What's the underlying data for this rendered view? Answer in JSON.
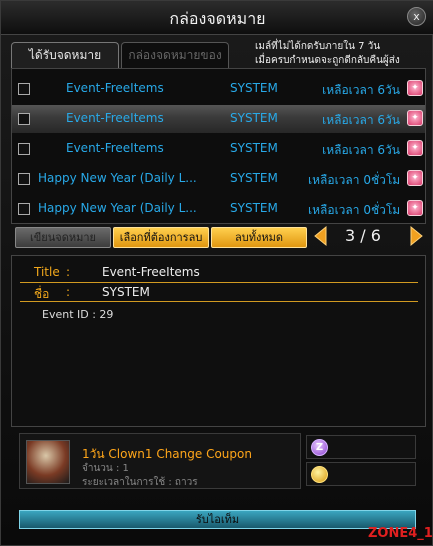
{
  "window": {
    "title": "กล่องจดหมาย",
    "close_label": "x"
  },
  "tabs": [
    {
      "label": "ได้รับจดหมาย",
      "active": true
    },
    {
      "label": "กล่องจดหมายของไอดี",
      "active": false
    }
  ],
  "notice": {
    "line1": "เมล์ที่ไม่ได้กดรับภายใน 7 วัน",
    "line2": "เมื่อครบกำหนดจะถูกดีกลับคืนผู้ส่ง"
  },
  "mail_list": [
    {
      "title": "Event-FreeItems",
      "sender": "SYSTEM",
      "time": "เหลือเวลา 6วัน",
      "checked": false,
      "selected": false
    },
    {
      "title": "Event-FreeItems",
      "sender": "SYSTEM",
      "time": "เหลือเวลา 6วัน",
      "checked": false,
      "selected": true
    },
    {
      "title": "Event-FreeItems",
      "sender": "SYSTEM",
      "time": "เหลือเวลา 6วัน",
      "checked": false,
      "selected": false
    },
    {
      "title": "Happy New Year (Daily L...",
      "sender": "SYSTEM",
      "time": "เหลือเวลา 0ชั่วโม",
      "checked": false,
      "selected": false
    },
    {
      "title": "Happy New Year (Daily L...",
      "sender": "SYSTEM",
      "time": "เหลือเวลา 0ชั่วโม",
      "checked": false,
      "selected": false
    }
  ],
  "actions": {
    "write": "เขียนจดหมาย",
    "delete_selected": "เลือกที่ต้องการลบ",
    "delete_all": "ลบทั้งหมด"
  },
  "pagination": {
    "current": 3,
    "total": 6,
    "display": "3 / 6"
  },
  "detail": {
    "title_label": "Title",
    "title_colon": ":",
    "title_value": "Event-FreeItems",
    "name_label": "ชื่อ",
    "name_colon": ":",
    "name_value": "SYSTEM",
    "body": "Event ID : 29"
  },
  "attachment": {
    "name": "1วัน Clown1 Change Coupon",
    "quantity": "จำนวน : 1",
    "duration": "ระยะเวลาในการใช้ : ถาวร"
  },
  "slots": [
    {
      "icon": "zeny-coin-icon",
      "value": ""
    },
    {
      "icon": "gold-coins-icon",
      "value": ""
    }
  ],
  "receive_button": "รับไอเท็ม",
  "watermark": "ZONE4_1",
  "colors": {
    "mail_text": "#28a9e8",
    "label_orange": "#f2a81c",
    "item_name": "#ffa61a",
    "button_yellow": "#f0b030",
    "receive_button": "#2a8aa4"
  }
}
